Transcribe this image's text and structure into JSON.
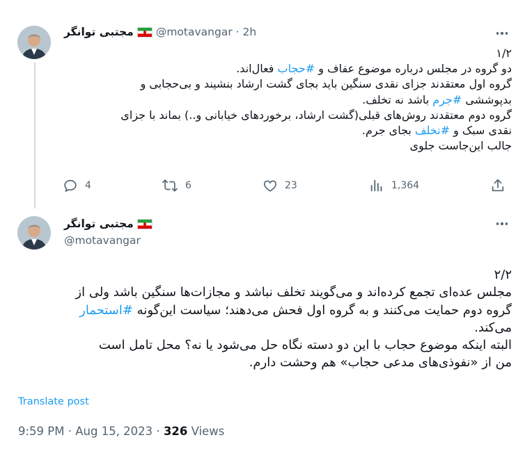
{
  "tweet1": {
    "display_name": "مجتبی توانگر",
    "handle": "@motavangar",
    "time": "2h",
    "counter": "۱/۲",
    "lines": [
      {
        "text": "دو گروه در مجلس درباره موضوع عفاف و ",
        "tag": "#حجاب",
        "after": " فعال‌اند."
      },
      {
        "text": "گروه اول معتقدند جزای نقدی سنگین باید بجای گشت ارشاد بنشیند و بی‌حجابی و",
        "tag": "",
        "after": ""
      },
      {
        "text": "بدپوششی ",
        "tag": "#جرم",
        "after": " باشد نه تخلف."
      },
      {
        "text": "گروه دوم معتقدند روش‌های قبلی(گشت ارشاد، برخوردهای خیابانی و..) بماند با جزای",
        "tag": "",
        "after": ""
      },
      {
        "text": "نقدی سبک و ",
        "tag": "#تخلف",
        "after": " بجای جرم."
      },
      {
        "text": "جالب این‌جاست جلوی",
        "tag": "",
        "after": ""
      }
    ],
    "stats": {
      "replies": "4",
      "retweets": "6",
      "likes": "23",
      "views": "1,364"
    }
  },
  "tweet2": {
    "display_name": "مجتبی توانگر",
    "handle": "@motavangar",
    "counter": "۲/۲",
    "lines": [
      {
        "text": "مجلس عده‌ای تجمع کرده‌اند و می‌گویند تخلف نباشد و مجازات‌ها سنگین باشد ولی از",
        "tag": "",
        "after": ""
      },
      {
        "text": "گروه دوم حمایت می‌کنند و به گروه اول فحش می‌دهند؛ سیاست این‌گونه ",
        "tag": "#استحمار",
        "after": ""
      },
      {
        "text": "می‌کند.",
        "tag": "",
        "after": ""
      },
      {
        "text": "البته اینکه موضوع حجاب با این دو دسته نگاه حل می‌شود یا نه؟ محل تامل است",
        "tag": "",
        "after": ""
      },
      {
        "text": "من از «نفوذی‌های مدعی حجاب» هم وحشت دارم.",
        "tag": "",
        "after": ""
      }
    ],
    "translate_label": "Translate post",
    "posted_time": "9:59 PM",
    "posted_date": "Aug 15, 2023",
    "views_count": "326",
    "views_label": "Views"
  },
  "colors": {
    "accent": "#1d9bf0",
    "muted": "#536471",
    "text": "#0f1419"
  },
  "icons": [
    "reply-icon",
    "retweet-icon",
    "like-icon",
    "views-icon",
    "share-icon",
    "more-icon",
    "iran-flag-icon"
  ]
}
